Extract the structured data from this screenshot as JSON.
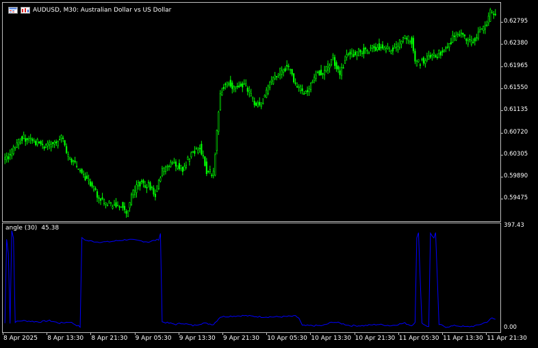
{
  "header": {
    "symbol_title": "AUDUSD, M30:  Australian Dollar vs US Dollar"
  },
  "indicator": {
    "name": "angle (30)",
    "value": "45.38"
  },
  "price_axis": [
    "0.62795",
    "0.62380",
    "0.61965",
    "0.61550",
    "0.61135",
    "0.60720",
    "0.60305",
    "0.59890",
    "0.59475"
  ],
  "indicator_axis": [
    "397.43",
    "0.00"
  ],
  "time_axis": [
    "8 Apr 2025",
    "8 Apr 13:30",
    "8 Apr 21:30",
    "9 Apr 05:30",
    "9 Apr 13:30",
    "9 Apr 21:30",
    "10 Apr 05:30",
    "10 Apr 13:30",
    "10 Apr 21:30",
    "11 Apr 05:30",
    "11 Apr 13:30",
    "11 Apr 21:30"
  ],
  "colors": {
    "candle": "#00ff00",
    "indicator_line": "#0000ff",
    "frame": "#c0c0c0",
    "background": "#000000"
  },
  "chart_data": [
    {
      "type": "candlestick",
      "title": "AUDUSD, M30:  Australian Dollar vs US Dollar",
      "ylim": [
        0.5922,
        0.6308
      ],
      "close_anchors": [
        [
          0,
          0.603
        ],
        [
          4,
          0.6045
        ],
        [
          10,
          0.607
        ],
        [
          16,
          0.6065
        ],
        [
          24,
          0.6055
        ],
        [
          30,
          0.606
        ],
        [
          33,
          0.6075
        ],
        [
          36,
          0.604
        ],
        [
          40,
          0.6025
        ],
        [
          48,
          0.5995
        ],
        [
          56,
          0.596
        ],
        [
          62,
          0.595
        ],
        [
          68,
          0.595
        ],
        [
          71,
          0.5935
        ],
        [
          74,
          0.5965
        ],
        [
          78,
          0.599
        ],
        [
          84,
          0.5985
        ],
        [
          88,
          0.597
        ],
        [
          92,
          0.601
        ],
        [
          98,
          0.6025
        ],
        [
          104,
          0.6015
        ],
        [
          108,
          0.6035
        ],
        [
          114,
          0.6055
        ],
        [
          118,
          0.601
        ],
        [
          122,
          0.6005
        ],
        [
          126,
          0.615
        ],
        [
          130,
          0.617
        ],
        [
          134,
          0.6155
        ],
        [
          140,
          0.6165
        ],
        [
          146,
          0.613
        ],
        [
          150,
          0.613
        ],
        [
          156,
          0.617
        ],
        [
          162,
          0.619
        ],
        [
          166,
          0.6195
        ],
        [
          170,
          0.616
        ],
        [
          176,
          0.615
        ],
        [
          182,
          0.618
        ],
        [
          188,
          0.619
        ],
        [
          192,
          0.621
        ],
        [
          196,
          0.618
        ],
        [
          200,
          0.6215
        ],
        [
          206,
          0.622
        ],
        [
          212,
          0.6225
        ],
        [
          218,
          0.623
        ],
        [
          224,
          0.6225
        ],
        [
          228,
          0.6225
        ],
        [
          234,
          0.625
        ],
        [
          238,
          0.624
        ],
        [
          240,
          0.62
        ],
        [
          244,
          0.6205
        ],
        [
          248,
          0.621
        ],
        [
          252,
          0.6215
        ],
        [
          258,
          0.6225
        ],
        [
          262,
          0.6245
        ],
        [
          266,
          0.6255
        ],
        [
          270,
          0.624
        ],
        [
          274,
          0.624
        ],
        [
          278,
          0.6255
        ],
        [
          282,
          0.627
        ],
        [
          284,
          0.629
        ],
        [
          287,
          0.6285
        ]
      ]
    },
    {
      "type": "line",
      "title": "angle (30)",
      "ylim": [
        0,
        397.43
      ],
      "series": [
        {
          "values_anchors": [
            [
              0,
              20
            ],
            [
              1,
              355
            ],
            [
              2,
              300
            ],
            [
              3,
              20
            ],
            [
              4,
              390
            ],
            [
              5,
              360
            ],
            [
              6,
              25
            ],
            [
              10,
              30
            ],
            [
              14,
              28
            ],
            [
              20,
              25
            ],
            [
              26,
              30
            ],
            [
              32,
              20
            ],
            [
              38,
              25
            ],
            [
              44,
              5
            ],
            [
              45,
              360
            ],
            [
              48,
              350
            ],
            [
              54,
              345
            ],
            [
              60,
              345
            ],
            [
              66,
              350
            ],
            [
              72,
              355
            ],
            [
              78,
              350
            ],
            [
              84,
              345
            ],
            [
              90,
              355
            ],
            [
              91,
              380
            ],
            [
              92,
              25
            ],
            [
              96,
              20
            ],
            [
              100,
              15
            ],
            [
              104,
              20
            ],
            [
              110,
              10
            ],
            [
              116,
              20
            ],
            [
              122,
              15
            ],
            [
              126,
              45
            ],
            [
              132,
              48
            ],
            [
              140,
              50
            ],
            [
              150,
              45
            ],
            [
              160,
              45
            ],
            [
              170,
              48
            ],
            [
              172,
              40
            ],
            [
              174,
              10
            ],
            [
              180,
              10
            ],
            [
              186,
              10
            ],
            [
              192,
              25
            ],
            [
              196,
              20
            ],
            [
              202,
              10
            ],
            [
              210,
              10
            ],
            [
              218,
              15
            ],
            [
              226,
              10
            ],
            [
              234,
              20
            ],
            [
              238,
              10
            ],
            [
              240,
              25
            ],
            [
              241,
              360
            ],
            [
              242,
              380
            ],
            [
              243,
              200
            ],
            [
              244,
              20
            ],
            [
              248,
              5
            ],
            [
              249,
              380
            ],
            [
              251,
              360
            ],
            [
              252,
              380
            ],
            [
              254,
              15
            ],
            [
              258,
              5
            ],
            [
              264,
              10
            ],
            [
              270,
              5
            ],
            [
              276,
              10
            ],
            [
              282,
              25
            ],
            [
              285,
              40
            ],
            [
              287,
              35
            ]
          ]
        }
      ]
    }
  ]
}
